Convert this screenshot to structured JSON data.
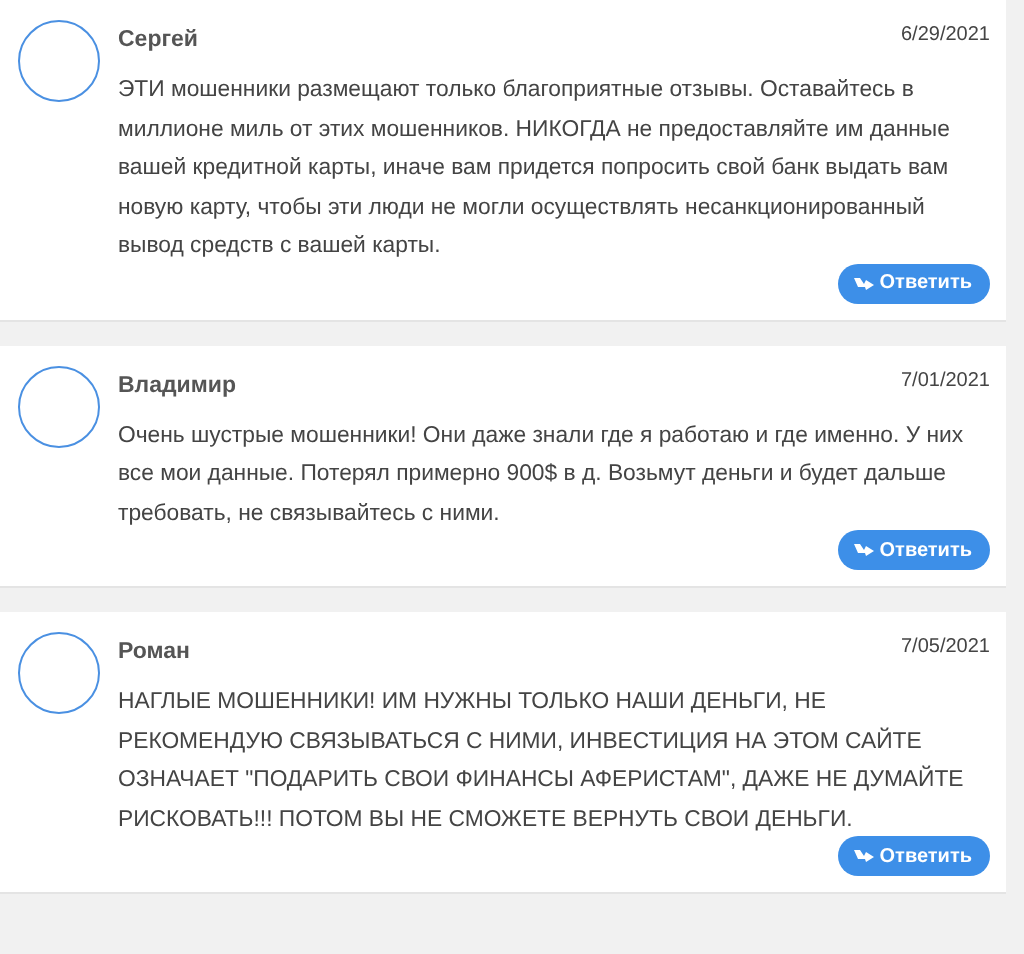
{
  "comments": [
    {
      "author": "Сергей",
      "date": "6/29/2021",
      "text": "ЭТИ мошенники размещают только благоприятные отзывы. Оставайтесь в миллионе миль от этих мошенников. НИКОГДА не предоставляйте им данные вашей кредитной карты, иначе вам придется попросить свой банк выдать вам новую карту, чтобы эти люди не могли осуществлять несанкционированный вывод средств с вашей карты.",
      "reply": "Ответить"
    },
    {
      "author": "Владимир",
      "date": "7/01/2021",
      "text": "Очень шустрые мошенники! Они даже знали где я работаю и где именно. У них все мои данные. Потерял примерно 900$ в д. Возьмут деньги и будет дальше требовать, не связывайтесь с ними.",
      "reply": "Ответить"
    },
    {
      "author": "Роман",
      "date": "7/05/2021",
      "text": "НАГЛЫЕ МОШЕННИКИ! ИМ НУЖНЫ ТОЛЬКО НАШИ ДЕНЬГИ, НЕ РЕКОМЕНДУЮ СВЯЗЫВАТЬСЯ С НИМИ, ИНВЕСТИЦИЯ НА ЭТОМ САЙТЕ ОЗНАЧАЕТ \"ПОДАРИТЬ СВОИ ФИНАНСЫ АФЕРИСТАМ\", ДАЖЕ НЕ ДУМАЙТЕ РИСКОВАТЬ!!! ПОТОМ ВЫ НЕ СМОЖЕТЕ ВЕРНУТЬ СВОИ ДЕНЬГИ.",
      "reply": "Ответить"
    }
  ]
}
